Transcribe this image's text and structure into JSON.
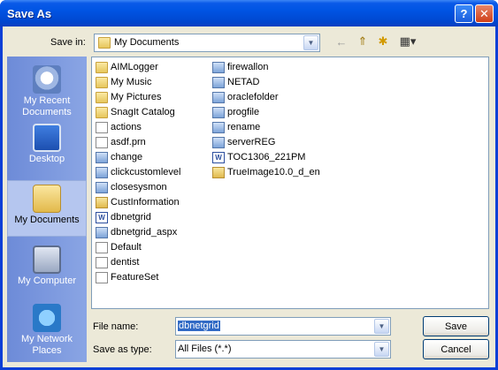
{
  "window": {
    "title": "Save As",
    "help_glyph": "?",
    "close_glyph": "✕"
  },
  "save_in": {
    "label": "Save in:",
    "value": "My Documents"
  },
  "toolbar": {
    "back_glyph": "←",
    "up_glyph": "⇑",
    "newfolder_glyph": "✱",
    "views_glyph": "▦▾"
  },
  "places": [
    {
      "label": "My Recent Documents"
    },
    {
      "label": "Desktop"
    },
    {
      "label": "My Documents"
    },
    {
      "label": "My Computer"
    },
    {
      "label": "My Network Places"
    }
  ],
  "files_col1": [
    {
      "name": "AIMLogger",
      "type": "folder"
    },
    {
      "name": "My Music",
      "type": "folder"
    },
    {
      "name": "My Pictures",
      "type": "folder"
    },
    {
      "name": "SnagIt Catalog",
      "type": "folder"
    },
    {
      "name": "actions",
      "type": "doc"
    },
    {
      "name": "asdf.prn",
      "type": "doc"
    },
    {
      "name": "change",
      "type": "app"
    },
    {
      "name": "clickcustomlevel",
      "type": "app"
    },
    {
      "name": "closesysmon",
      "type": "app"
    },
    {
      "name": "CustInformation",
      "type": "special"
    },
    {
      "name": "dbnetgrid",
      "type": "word"
    },
    {
      "name": "dbnetgrid_aspx",
      "type": "app"
    },
    {
      "name": "Default",
      "type": "doc"
    },
    {
      "name": "dentist",
      "type": "doc"
    },
    {
      "name": "FeatureSet",
      "type": "doc"
    }
  ],
  "files_col2": [
    {
      "name": "firewallon",
      "type": "app"
    },
    {
      "name": "NETAD",
      "type": "app"
    },
    {
      "name": "oraclefolder",
      "type": "app"
    },
    {
      "name": "progfile",
      "type": "app"
    },
    {
      "name": "rename",
      "type": "app"
    },
    {
      "name": "serverREG",
      "type": "app"
    },
    {
      "name": "TOC1306_221PM",
      "type": "word"
    },
    {
      "name": "TrueImage10.0_d_en",
      "type": "special"
    }
  ],
  "file_name": {
    "label": "File name:",
    "value": "dbnetgrid"
  },
  "save_as_type": {
    "label": "Save as type:",
    "value": "All Files (*.*)"
  },
  "buttons": {
    "save": "Save",
    "cancel": "Cancel"
  },
  "colors": {
    "title_bar": "#0054e3",
    "places_bar": "#7a96df",
    "dialog_bg": "#ece9d8",
    "selection": "#316ac5"
  }
}
